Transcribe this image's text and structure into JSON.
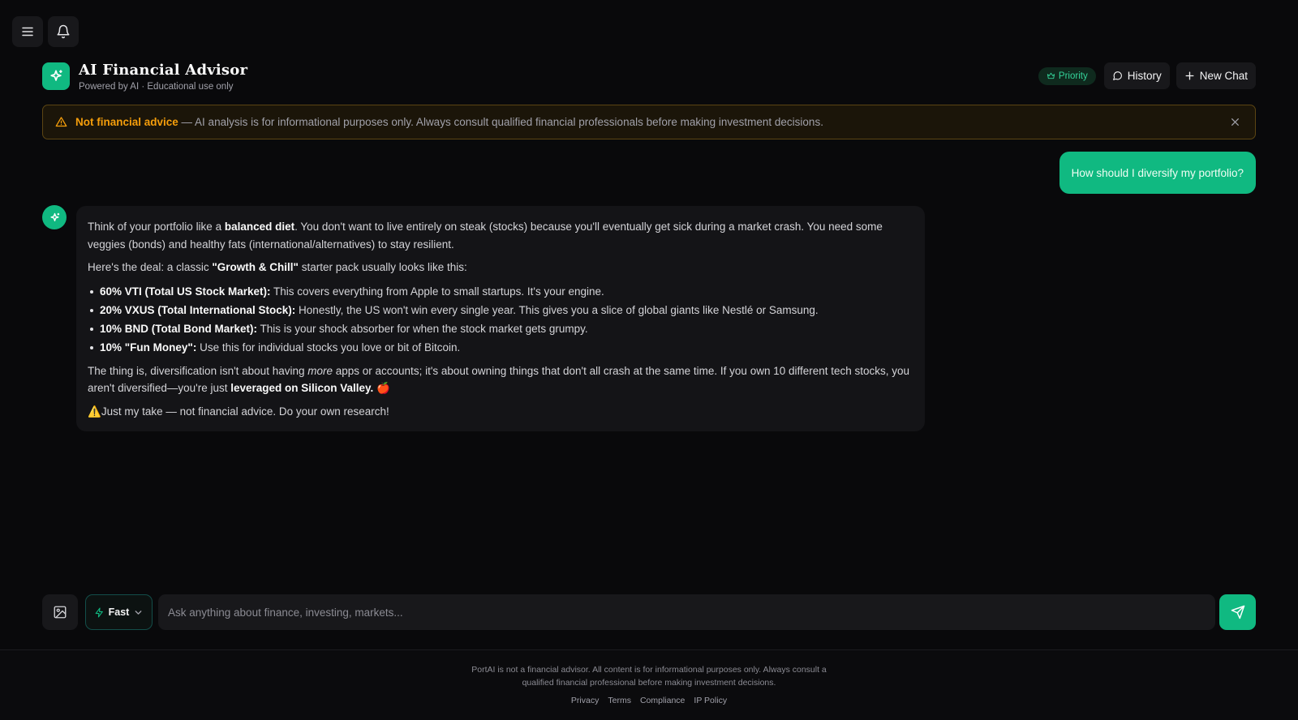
{
  "app": {
    "title": "AI Financial Advisor",
    "subtitle": "Powered by AI · Educational use only"
  },
  "header": {
    "priority_label": "Priority",
    "history_label": "History",
    "new_chat_label": "New Chat"
  },
  "disclaimer": {
    "strong": "Not financial advice",
    "text": " — AI analysis is for informational purposes only. Always consult qualified financial professionals before making investment decisions."
  },
  "chat": {
    "user_message": "How should I diversify my portfolio?",
    "assistant": {
      "p1_a": "Think of your portfolio like a ",
      "p1_b": "balanced diet",
      "p1_c": ". You don't want to live entirely on steak (stocks) because you'll eventually get sick during a market crash. You need some veggies (bonds) and healthy fats (international/alternatives) to stay resilient.",
      "p2_a": "Here's the deal: a classic ",
      "p2_b": "\"Growth & Chill\"",
      "p2_c": " starter pack usually looks like this:",
      "bullets": [
        {
          "bold": "60% VTI (Total US Stock Market):",
          "text": " This covers everything from Apple to small startups. It's your engine."
        },
        {
          "bold": "20% VXUS (Total International Stock):",
          "text": " Honestly, the US won't win every single year. This gives you a slice of global giants like Nestlé or Samsung."
        },
        {
          "bold": "10% BND (Total Bond Market):",
          "text": " This is your shock absorber for when the stock market gets grumpy."
        },
        {
          "bold": "10% \"Fun Money\":",
          "text": " Use this for individual stocks you love or bit of Bitcoin."
        }
      ],
      "p3_a": "The thing is, diversification isn't about having ",
      "p3_em": "more",
      "p3_b": " apps or accounts; it's about owning things that don't all crash at the same time. If you own 10 different tech stocks, you aren't diversified—you're just ",
      "p3_bold": "leveraged on Silicon Valley.",
      "p3_emoji": "🍎",
      "p4_emoji": "⚠️",
      "p4": "Just my take — not financial advice. Do your own research!"
    }
  },
  "composer": {
    "mode_label": "Fast",
    "placeholder": "Ask anything about finance, investing, markets..."
  },
  "footer": {
    "note": "PortAI is not a financial advisor. All content is for informational purposes only. Always consult a qualified financial professional before making investment decisions.",
    "links": [
      "Privacy",
      "Terms",
      "Compliance",
      "IP Policy"
    ]
  },
  "icons": {
    "menu": "menu-icon",
    "notifications": "bell-icon",
    "logo": "sparkles-icon",
    "priority": "crown-icon",
    "history": "message-circle-icon",
    "new_chat": "plus-icon",
    "warning": "alert-triangle-icon",
    "close": "close-icon",
    "image": "image-icon",
    "fast": "zap-icon",
    "dropdown": "chevron-down-icon",
    "send": "send-icon"
  },
  "colors": {
    "background": "#09090b",
    "accent": "#10b981",
    "warning": "#f59e0b",
    "surface": "#18181b"
  }
}
